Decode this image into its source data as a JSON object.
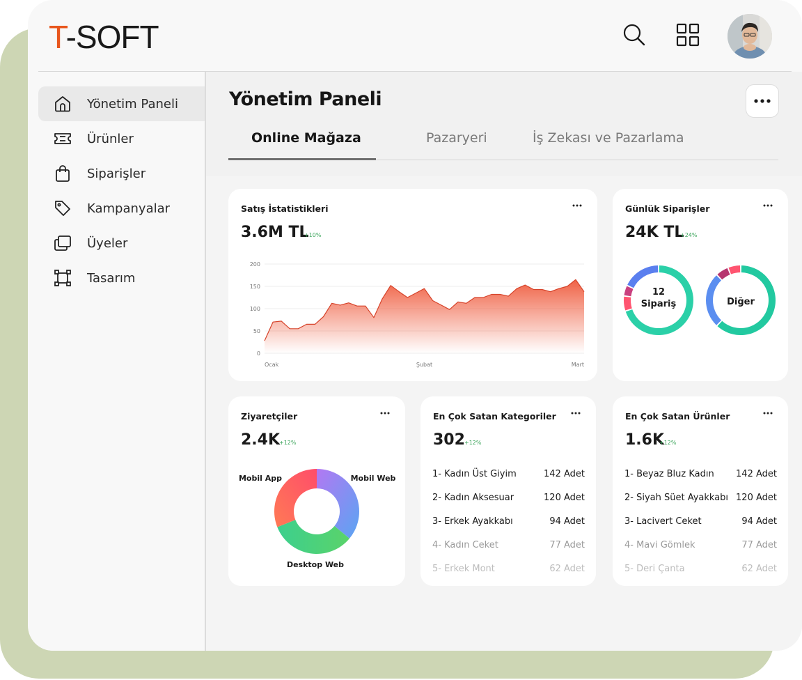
{
  "brand": {
    "logo_first": "T",
    "logo_rest": "-SOFT",
    "accent": "#e8561d"
  },
  "header": {
    "icons": [
      "search-icon",
      "apps-grid-icon",
      "user-avatar"
    ]
  },
  "sidebar": {
    "items": [
      {
        "label": "Yönetim Paneli",
        "icon": "home-icon",
        "active": true
      },
      {
        "label": "Ürünler",
        "icon": "ticket-icon",
        "active": false
      },
      {
        "label": "Siparişler",
        "icon": "shopping-bag-icon",
        "active": false
      },
      {
        "label": "Kampanyalar",
        "icon": "tag-icon",
        "active": false
      },
      {
        "label": "Üyeler",
        "icon": "folders-icon",
        "active": false
      },
      {
        "label": "Tasarım",
        "icon": "frame-icon",
        "active": false
      }
    ]
  },
  "main": {
    "title": "Yönetim Paneli",
    "tabs": [
      {
        "label": "Online Mağaza",
        "active": true
      },
      {
        "label": "Pazaryeri",
        "active": false
      },
      {
        "label": "İş Zekası ve Pazarlama",
        "active": false
      }
    ]
  },
  "cards": {
    "sales": {
      "title": "Satış İstatistikleri",
      "value": "3.6M TL",
      "delta": "+10%"
    },
    "daily": {
      "title": "Günlük Siparişler",
      "value": "24K TL",
      "delta": "+24%",
      "donut1_label_line1": "12",
      "donut1_label_line2": "Sipariş",
      "donut2_label": "Diğer"
    },
    "visitors": {
      "title": "Ziyaretçiler",
      "value": "2.4K",
      "delta": "+12%"
    },
    "categories": {
      "title": "En Çok Satan Kategoriler",
      "value": "302",
      "delta": "+12%",
      "rows": [
        {
          "name": "1- Kadın Üst Giyim",
          "count": "142 Adet"
        },
        {
          "name": "2- Kadın Aksesuar",
          "count": "120 Adet"
        },
        {
          "name": "3- Erkek Ayakkabı",
          "count": "94 Adet"
        },
        {
          "name": "4- Kadın Ceket",
          "count": "77 Adet"
        },
        {
          "name": "5- Erkek Mont",
          "count": "62 Adet"
        }
      ]
    },
    "products": {
      "title": "En Çok Satan Ürünler",
      "value": "1.6K",
      "delta": "+12%",
      "rows": [
        {
          "name": "1- Beyaz Bluz Kadın",
          "count": "142 Adet"
        },
        {
          "name": "2- Siyah Süet Ayakkabı",
          "count": "120 Adet"
        },
        {
          "name": "3- Lacivert Ceket",
          "count": "94 Adet"
        },
        {
          "name": "4- Mavi Gömlek",
          "count": "77 Adet"
        },
        {
          "name": "5- Deri Çanta",
          "count": "62 Adet"
        }
      ]
    }
  },
  "chart_data": [
    {
      "type": "area",
      "title": "Satış İstatistikleri",
      "ylim": [
        0,
        200
      ],
      "yticks": [
        0,
        50,
        100,
        150,
        200
      ],
      "xticks": [
        "Ocak",
        "Şubat",
        "Mart"
      ],
      "grid": true,
      "color": "#e8502f",
      "series": [
        {
          "values": [
            28,
            70,
            72,
            55,
            55,
            65,
            65,
            82,
            112,
            108,
            113,
            106,
            106,
            80,
            122,
            152,
            138,
            125,
            135,
            145,
            118,
            108,
            98,
            115,
            112,
            125,
            125,
            132,
            132,
            128,
            145,
            153,
            143,
            143,
            138,
            145,
            150,
            165,
            138
          ]
        }
      ]
    },
    {
      "type": "pie",
      "title": "Ziyaretçiler",
      "donut": true,
      "slices": [
        {
          "label": "Mobil Web",
          "value": 36
        },
        {
          "label": "Desktop Web",
          "value": 33
        },
        {
          "label": "Mobil App",
          "value": 31
        }
      ]
    },
    {
      "type": "pie",
      "title": "Günlük Siparişler",
      "donut": true,
      "slices": [
        {
          "label": "12 Sipariş",
          "value": 70
        },
        {
          "label": "",
          "value": 7
        },
        {
          "label": "",
          "value": 5
        },
        {
          "label": "",
          "value": 18
        }
      ]
    },
    {
      "type": "pie",
      "title": "Günlük Siparişler",
      "donut": true,
      "slices": [
        {
          "label": "Diğer",
          "value": 62
        },
        {
          "label": "",
          "value": 26
        },
        {
          "label": "",
          "value": 6
        },
        {
          "label": "",
          "value": 6
        }
      ]
    }
  ]
}
